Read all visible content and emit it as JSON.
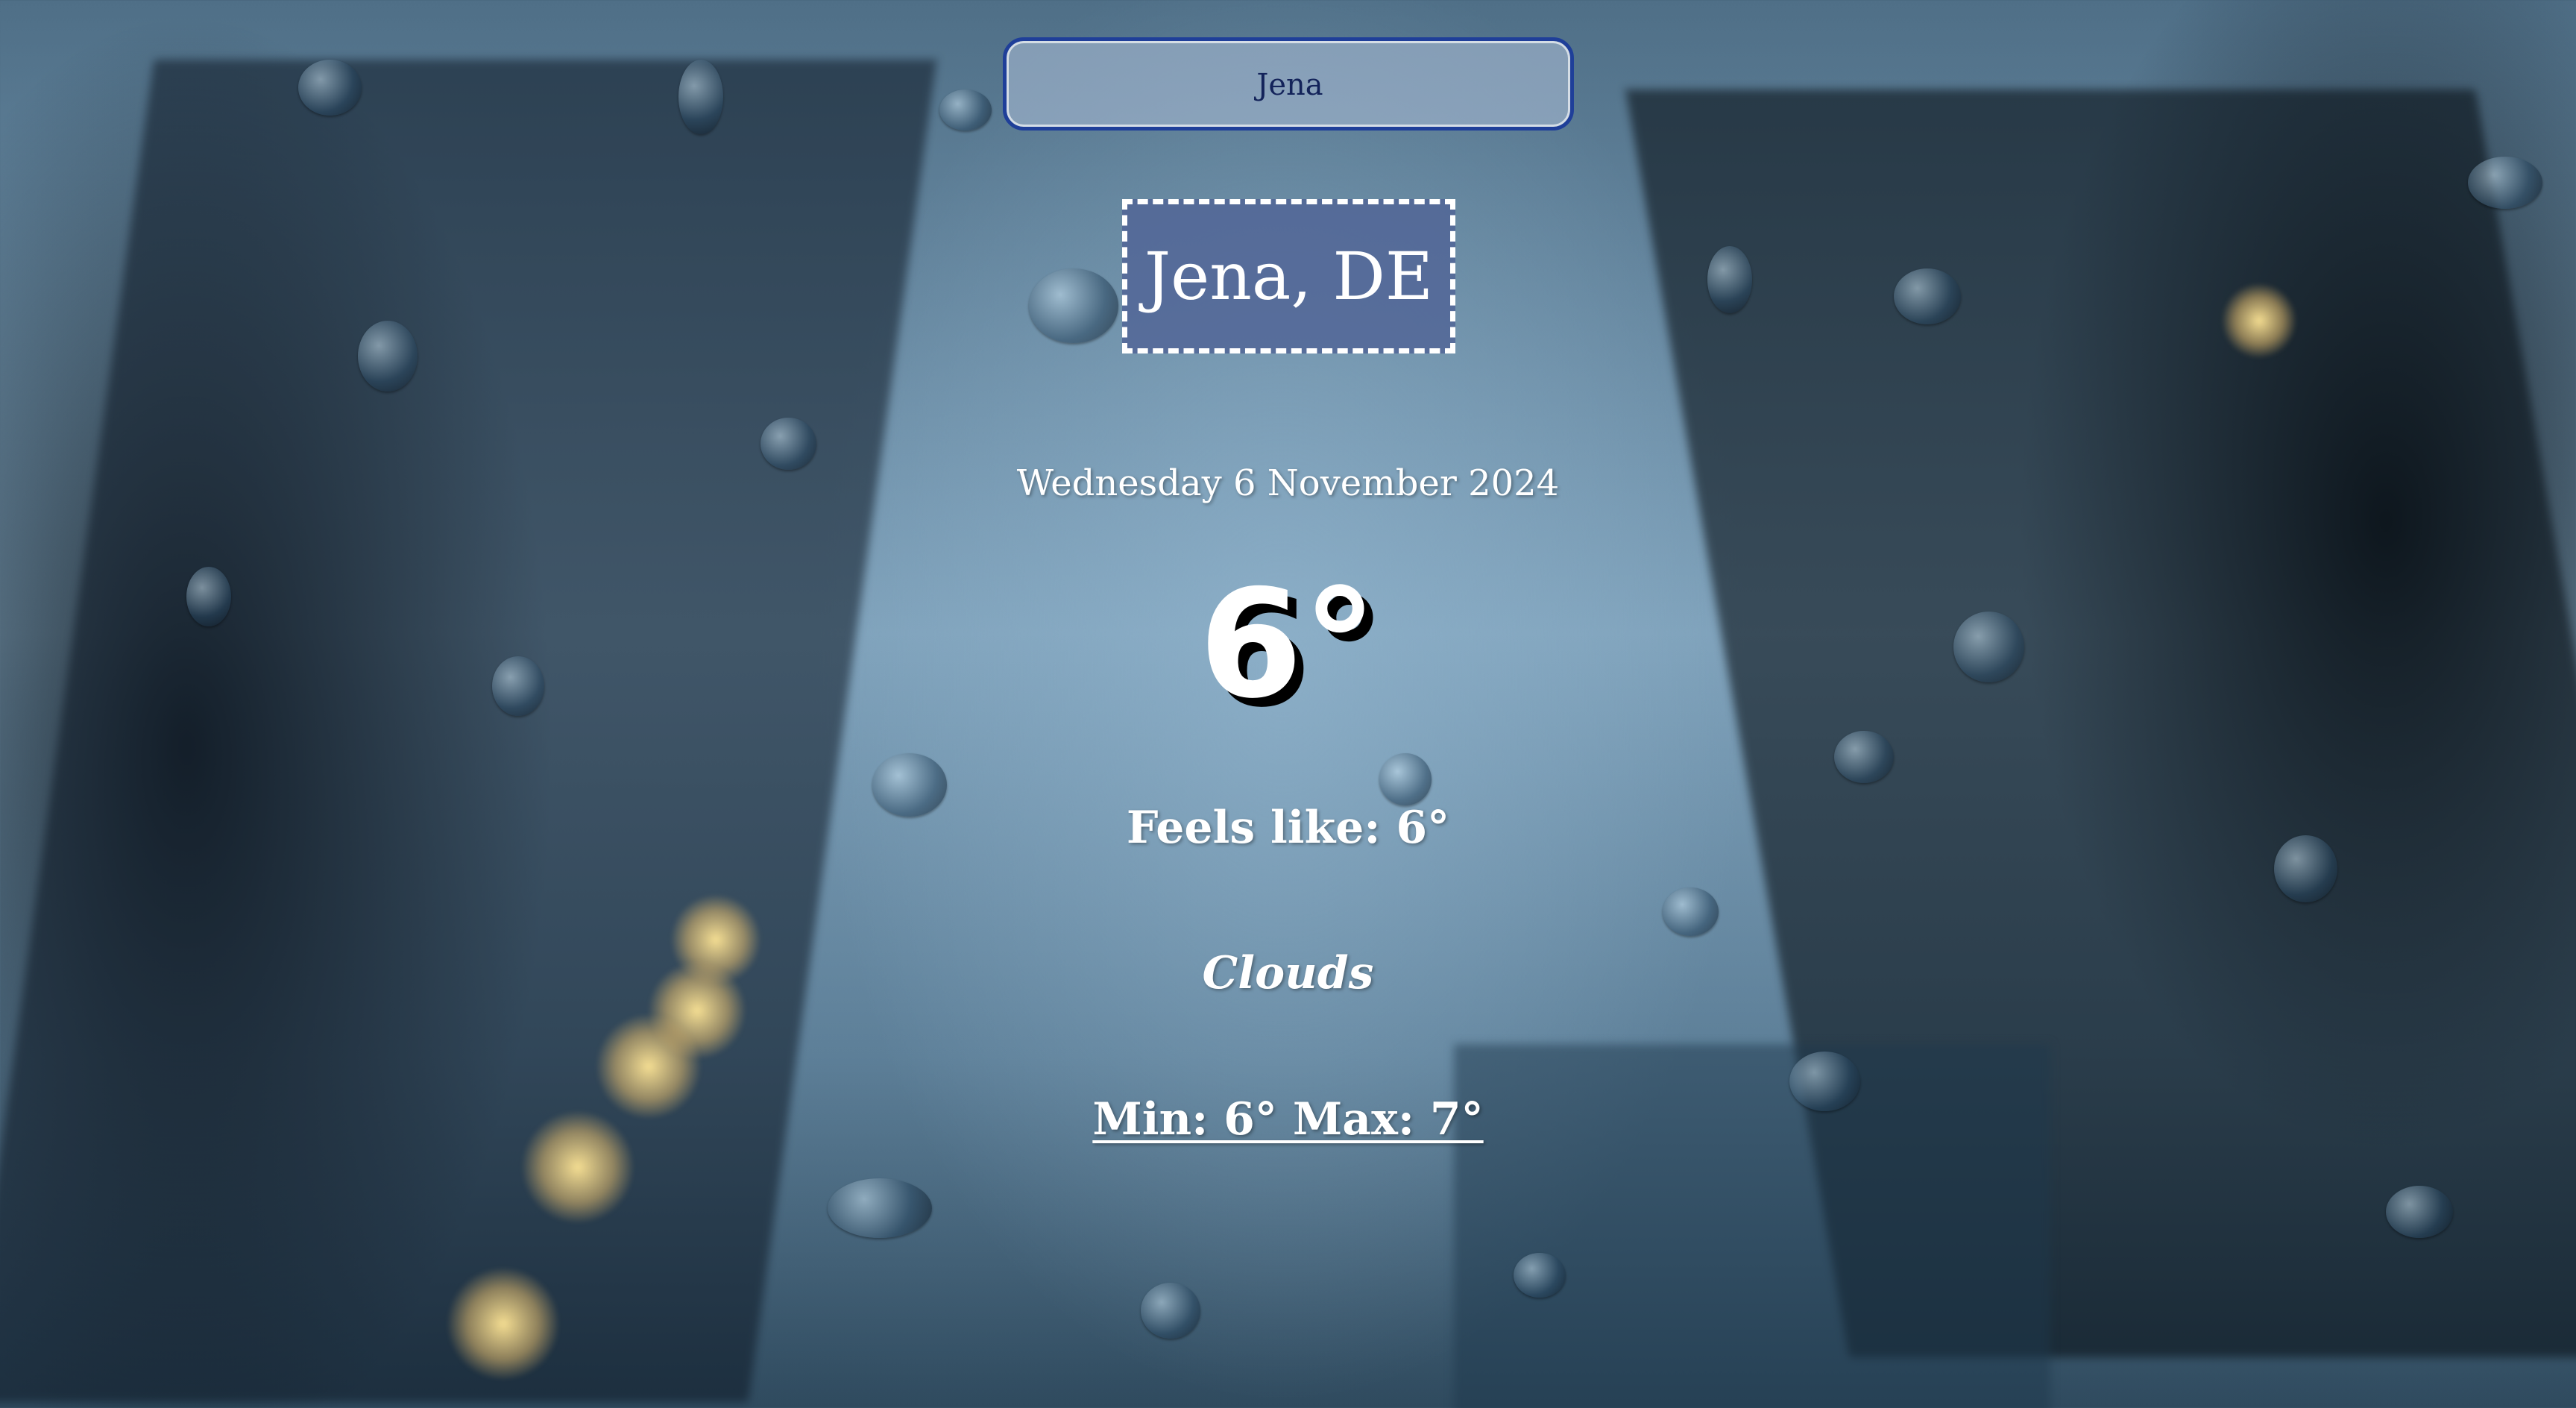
{
  "search": {
    "value": "Jena"
  },
  "location": {
    "title": "Jena, DE"
  },
  "weather": {
    "date": "Wednesday 6 November 2024",
    "temperature": "6°",
    "feels_like": "Feels like: 6°",
    "condition": "Clouds",
    "min_max": "Min: 6° Max: 7°"
  },
  "theme": {
    "search_border": "#1f3f99",
    "location_bg": "#50649a",
    "text": "#ffffff"
  }
}
